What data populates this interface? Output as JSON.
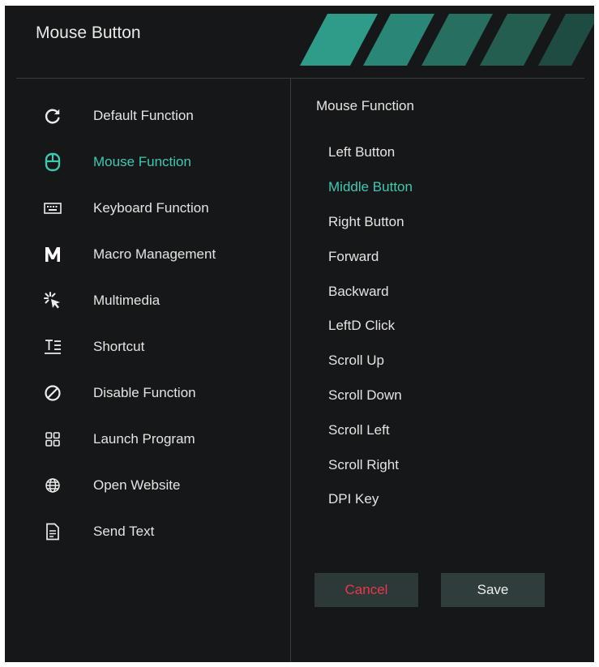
{
  "header": {
    "title": "Mouse Button"
  },
  "colors": {
    "accent": "#3fc9b0",
    "text": "#e4e4e4",
    "cancel_text": "#e8384a",
    "panel_bg": "#161718"
  },
  "menu": {
    "items": [
      {
        "label": "Default Function",
        "icon": "refresh-icon",
        "active": false
      },
      {
        "label": "Mouse Function",
        "icon": "mouse-icon",
        "active": true
      },
      {
        "label": "Keyboard Function",
        "icon": "keyboard-icon",
        "active": false
      },
      {
        "label": "Macro Management",
        "icon": "macro-m-icon",
        "active": false
      },
      {
        "label": "Multimedia",
        "icon": "multimedia-icon",
        "active": false
      },
      {
        "label": "Shortcut",
        "icon": "shortcut-icon",
        "active": false
      },
      {
        "label": "Disable Function",
        "icon": "disable-icon",
        "active": false
      },
      {
        "label": "Launch Program",
        "icon": "grid-icon",
        "active": false
      },
      {
        "label": "Open Website",
        "icon": "globe-icon",
        "active": false
      },
      {
        "label": "Send Text",
        "icon": "document-icon",
        "active": false
      }
    ]
  },
  "submenu": {
    "title": "Mouse Function",
    "items": [
      {
        "label": "Left Button",
        "active": false
      },
      {
        "label": "Middle Button",
        "active": true
      },
      {
        "label": "Right Button",
        "active": false
      },
      {
        "label": "Forward",
        "active": false
      },
      {
        "label": "Backward",
        "active": false
      },
      {
        "label": "LeftD Click",
        "active": false
      },
      {
        "label": "Scroll Up",
        "active": false
      },
      {
        "label": "Scroll Down",
        "active": false
      },
      {
        "label": "Scroll Left",
        "active": false
      },
      {
        "label": "Scroll Right",
        "active": false
      },
      {
        "label": "DPI Key",
        "active": false
      }
    ]
  },
  "footer": {
    "cancel_label": "Cancel",
    "save_label": "Save"
  }
}
